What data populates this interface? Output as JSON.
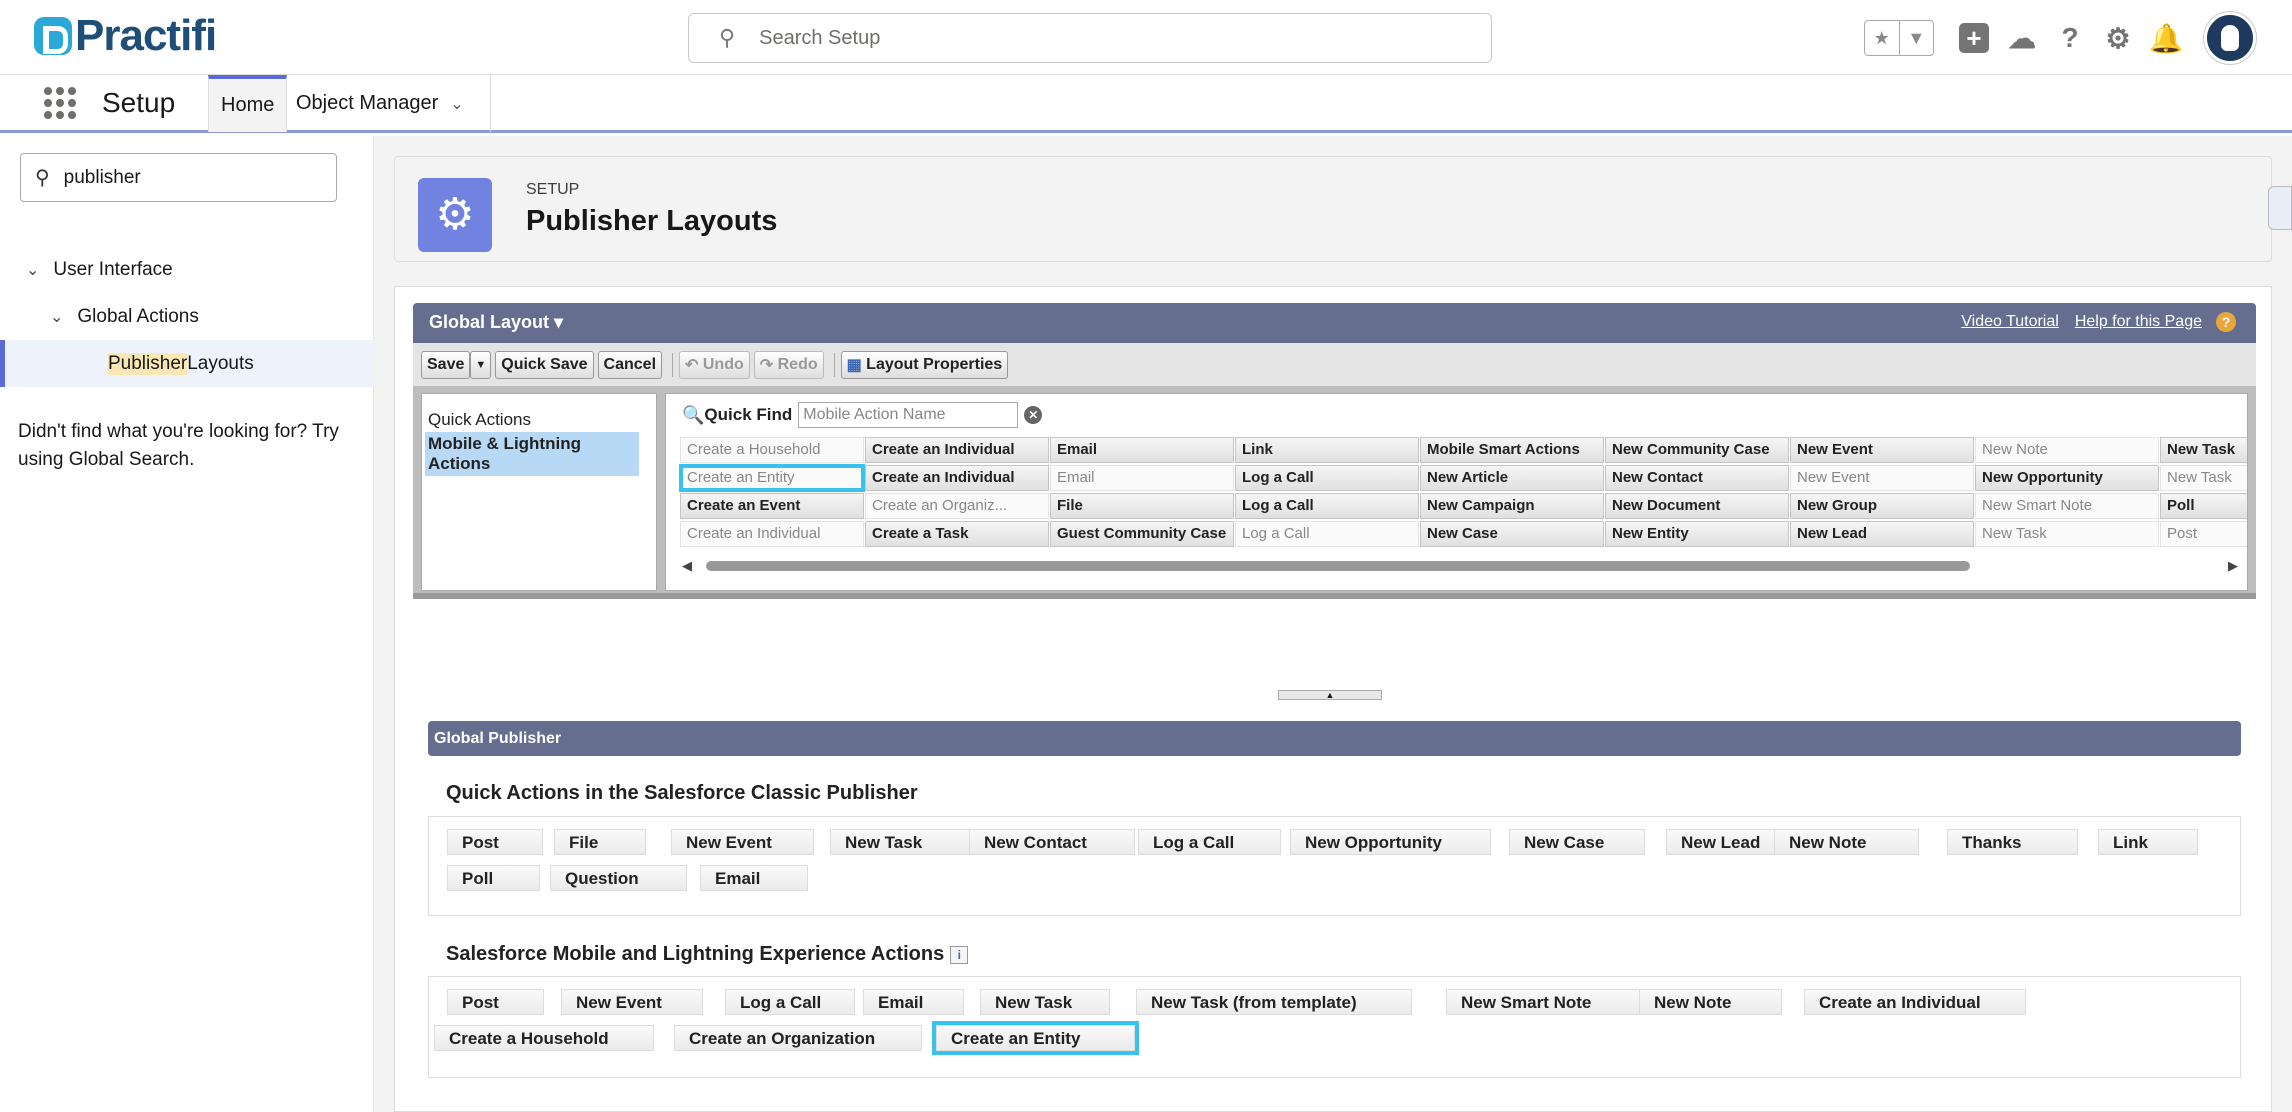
{
  "header": {
    "logo_text": "Practifi",
    "search_placeholder": "Search Setup",
    "icons": [
      "star-icon",
      "chevron-down-icon",
      "plus-icon",
      "trailhead-icon",
      "help-icon",
      "gear-icon",
      "bell-icon",
      "avatar"
    ]
  },
  "nav": {
    "app_name": "Setup",
    "tabs": [
      {
        "label": "Home"
      },
      {
        "label": "Object Manager"
      }
    ]
  },
  "sidebar": {
    "quick_find_value": "publisher",
    "tree": {
      "level1": "User Interface",
      "level2": "Global Actions",
      "level3_match": "Publisher",
      "level3_rest": " Layouts"
    },
    "not_found": "Didn't find what you're looking for? Try using Global Search."
  },
  "page": {
    "breadcrumb": "SETUP",
    "title": "Publisher Layouts"
  },
  "layout_bar": {
    "title": "Global Layout ▾",
    "video_tutorial": "Video Tutorial",
    "help_link": "Help for this Page",
    "help_q": "?"
  },
  "toolbar": {
    "save": "Save",
    "save_menu": "▼",
    "quick_save": "Quick Save",
    "cancel": "Cancel",
    "undo": "Undo",
    "redo": "Redo",
    "layout_properties": "Layout Properties"
  },
  "palette": {
    "categories": [
      "Quick Actions",
      "Mobile & Lightning Actions"
    ],
    "quick_find_label": "Quick Find",
    "quick_find_placeholder": "Mobile Action Name",
    "rows": [
      [
        {
          "t": "Create a Household",
          "u": true
        },
        {
          "t": "Create an Individual"
        },
        {
          "t": "Email"
        },
        {
          "t": "Link"
        },
        {
          "t": "Mobile Smart Actions"
        },
        {
          "t": "New Community Case"
        },
        {
          "t": "New Event"
        },
        {
          "t": "New Note",
          "u": true
        },
        {
          "t": "New Task"
        }
      ],
      [
        {
          "t": "Create an Entity",
          "u": true,
          "h": true
        },
        {
          "t": "Create an Individual"
        },
        {
          "t": "Email",
          "u": true
        },
        {
          "t": "Log a Call"
        },
        {
          "t": "New Article"
        },
        {
          "t": "New Contact"
        },
        {
          "t": "New Event",
          "u": true
        },
        {
          "t": "New Opportunity"
        },
        {
          "t": "New Task",
          "u": true
        }
      ],
      [
        {
          "t": "Create an Event"
        },
        {
          "t": "Create an Organiz...",
          "u": true
        },
        {
          "t": "File"
        },
        {
          "t": "Log a Call"
        },
        {
          "t": "New Campaign"
        },
        {
          "t": "New Document"
        },
        {
          "t": "New Group"
        },
        {
          "t": "New Smart Note",
          "u": true
        },
        {
          "t": "Poll"
        }
      ],
      [
        {
          "t": "Create an Individual",
          "u": true
        },
        {
          "t": "Create a Task"
        },
        {
          "t": "Guest Community Case"
        },
        {
          "t": "Log a Call",
          "u": true
        },
        {
          "t": "New Case"
        },
        {
          "t": "New Entity"
        },
        {
          "t": "New Lead"
        },
        {
          "t": "New Task",
          "u": true
        },
        {
          "t": "Post",
          "u": true
        }
      ]
    ]
  },
  "publisher": {
    "bar_title": "Global Publisher",
    "classic_title": "Quick Actions in the Salesforce Classic Publisher",
    "classic_actions": [
      "Post",
      "File",
      "New Event",
      "New Task",
      "New Contact",
      "Log a Call",
      "New Opportunity",
      "New Case",
      "New Lead",
      "New Note",
      "Thanks",
      "Link",
      "Poll",
      "Question",
      "Email"
    ],
    "mobile_title": "Salesforce Mobile and Lightning Experience Actions",
    "mobile_info": "i",
    "mobile_actions": [
      "Post",
      "New Event",
      "Log a Call",
      "Email",
      "New Task",
      "New Task (from template)",
      "New Smart Note",
      "New Note",
      "Create an Individual",
      "Create a Household",
      "Create an Organization",
      "Create an Entity"
    ]
  }
}
